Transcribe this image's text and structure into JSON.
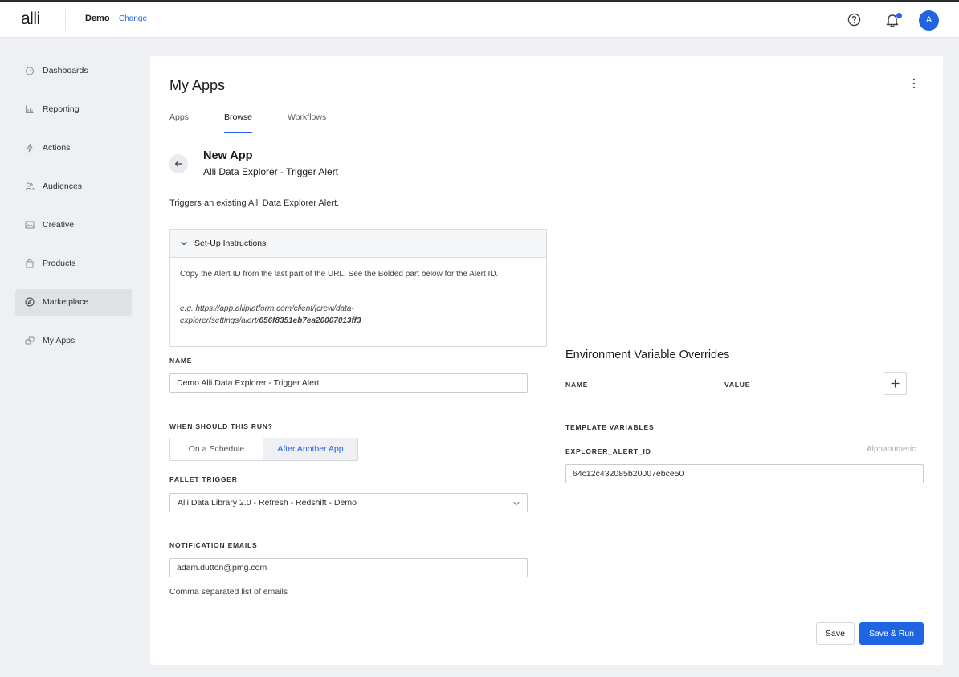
{
  "header": {
    "logo": "alli",
    "org_name": "Demo",
    "org_change": "Change",
    "avatar_initial": "A",
    "accent": "#2563eb"
  },
  "sidebar": {
    "items": [
      {
        "label": "Dashboards",
        "icon": "dashboard-icon"
      },
      {
        "label": "Reporting",
        "icon": "chart-icon"
      },
      {
        "label": "Actions",
        "icon": "lightning-icon"
      },
      {
        "label": "Audiences",
        "icon": "audience-icon"
      },
      {
        "label": "Creative",
        "icon": "image-icon"
      },
      {
        "label": "Products",
        "icon": "bag-icon"
      },
      {
        "label": "Marketplace",
        "icon": "compass-icon",
        "active": true
      },
      {
        "label": "My Apps",
        "icon": "apps-icon"
      }
    ]
  },
  "main": {
    "title": "My Apps",
    "tabs": [
      {
        "label": "Apps"
      },
      {
        "label": "Browse",
        "active": true
      },
      {
        "label": "Workflows"
      }
    ],
    "app_heading": "New App",
    "app_subheading": "Alli Data Explorer - Trigger Alert",
    "description": "Triggers an existing Alli Data Explorer Alert.",
    "setup": {
      "title": "Set-Up Instructions",
      "body": "Copy the Alert ID from the last part of the URL. See the Bolded part below for the Alert ID.",
      "example_prefix": "e.g. https://app.alliplatform.com/client/jcrew/data-explorer/settings/alert/",
      "example_bold": "656f8351eb7ea20007013ff3"
    },
    "name_label": "NAME",
    "name_value": "Demo Alli Data Explorer - Trigger Alert",
    "run_label": "WHEN SHOULD THIS RUN?",
    "run_options": [
      "On a Schedule",
      "After Another App"
    ],
    "run_selected": "After Another App",
    "trigger_label": "PALLET TRIGGER",
    "trigger_value": "Alli Data Library 2.0 - Refresh - Redshift - Demo",
    "emails_label": "NOTIFICATION EMAILS",
    "emails_value": "adam.dutton@pmg.com",
    "emails_hint": "Comma separated list of emails",
    "env": {
      "title": "Environment Variable Overrides",
      "col_name": "NAME",
      "col_value": "VALUE",
      "template_label": "TEMPLATE VARIABLES",
      "var_name": "EXPLORER_ALERT_ID",
      "var_type": "Alphanumeric",
      "var_value": "64c12c432085b20007ebce50"
    },
    "actions": {
      "save": "Save",
      "save_run": "Save & Run"
    }
  }
}
